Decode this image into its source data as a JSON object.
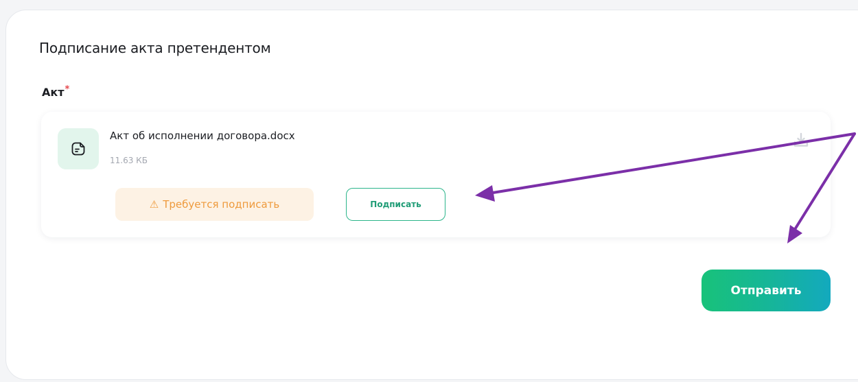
{
  "form": {
    "title": "Подписание акта претендентом",
    "field_label": "Акт",
    "required_mark": "*"
  },
  "file": {
    "name": "Акт об исполнении договора.docx",
    "size": "11.63 КБ",
    "icon": "document-icon",
    "download_icon": "download-icon"
  },
  "status": {
    "warning_icon": "⚠",
    "warning_text": "Требуется подписать"
  },
  "actions": {
    "sign_label": "Подписать",
    "send_label": "Отправить"
  },
  "colors": {
    "accent": "#1fb98f",
    "warning_text": "#ee9a3c",
    "warning_bg": "#fdf2e4",
    "annotation_arrow": "#7b2fa8",
    "required": "#e5484d"
  }
}
